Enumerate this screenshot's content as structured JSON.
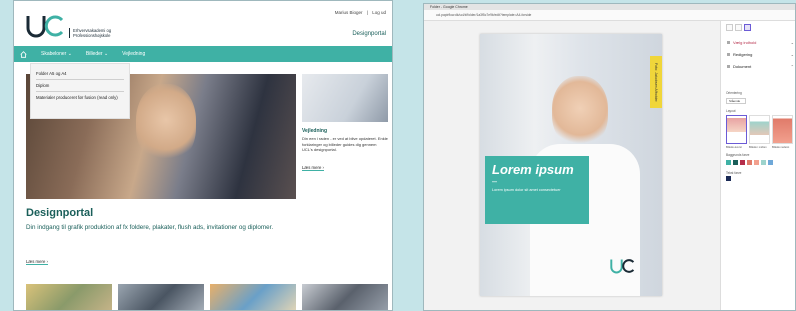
{
  "left": {
    "logo_text": "ucl",
    "institution": [
      "Erhvervsakademi og",
      "Professionshøjskole"
    ],
    "user_name": "Marius Bioger",
    "separator": "|",
    "logout": "Log ud",
    "portal_label": "Designportal",
    "nav": {
      "items": [
        {
          "label": "Skabeloner",
          "arrow": "⌄"
        },
        {
          "label": "Billeder",
          "arrow": "⌄"
        },
        {
          "label": "Vejledning",
          "arrow": ""
        }
      ]
    },
    "dropdown": [
      "Folder A5 og A4",
      "Diplom",
      "Materialer produceret før fusion (read only)"
    ],
    "aside": {
      "title": "Vejledning",
      "text": "Din een i raden - er ved at blive opdateret. Enkle forklaringer og billeder guides dig gennem UCL's designportal.",
      "link": "Læs mere"
    },
    "title": "Designportal",
    "subtitle": "Din indgang til grafik produktion af fx foldere, plakater, flush ads, invitationer og diplomer.",
    "link": "Læs mere"
  },
  "right": {
    "tab_title": "Folder - Google Chrome",
    "url": "ucl.papirflow.dk/ucl/#/folder/1a3f5c7e9b/edit?template=A4-forside",
    "yellow_tag": "Foto: Jakobsen Afholder",
    "lorem": "Lorem ipsum",
    "dash": "–",
    "lorem_small": "Lorem ipsum dolor sit amet consectetuer",
    "side": {
      "sections": [
        "Vælg indhold",
        "Redigering",
        "Dokument"
      ],
      "orientation_label": "Orientering",
      "orientation_value": "Stående",
      "layout_label": "Layout",
      "layout_captions": [
        "Billede øverst",
        "Billede i midten",
        "Billede nederst"
      ],
      "colors_label": "Baggrunds farve",
      "text_color_label": "Tekst farve",
      "swatches": [
        "#3fb1a5",
        "#1a5f5a",
        "#b52d4a",
        "#e07b6a",
        "#f2a08e",
        "#9dd3cc",
        "#6fa8d8"
      ],
      "text_swatch": "#1a2a55"
    }
  }
}
